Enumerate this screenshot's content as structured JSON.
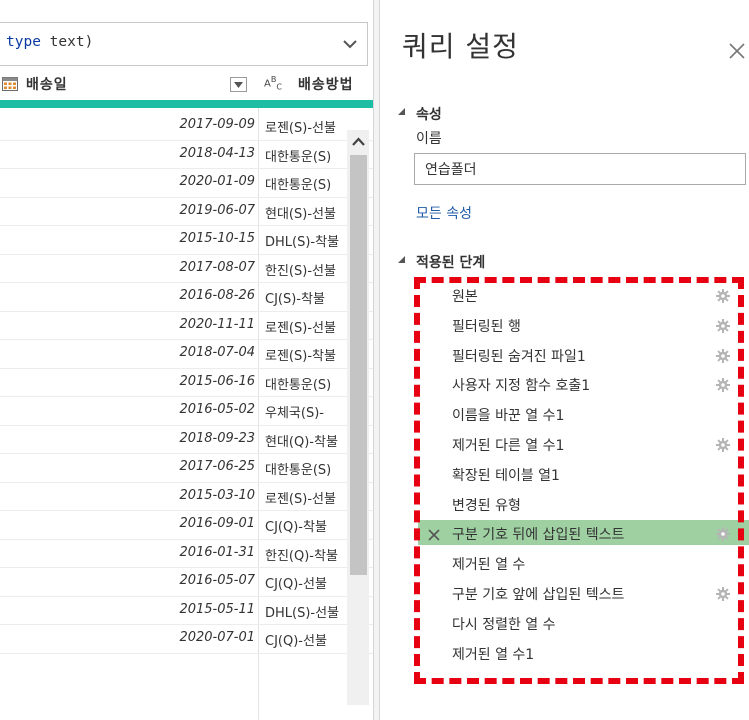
{
  "formula": {
    "kw": "type",
    "text": " text)"
  },
  "grid": {
    "date_column": "배송일",
    "ship_column": "배송방법",
    "type_badge": {
      "a": "A",
      "b": "B",
      "c": "C"
    },
    "rows": [
      {
        "date": "2017-09-09",
        "ship": "로젠(S)-선불"
      },
      {
        "date": "2018-04-13",
        "ship": "대한통운(S)"
      },
      {
        "date": "2020-01-09",
        "ship": "대한통운(S)"
      },
      {
        "date": "2019-06-07",
        "ship": "현대(S)-선불"
      },
      {
        "date": "2015-10-15",
        "ship": "DHL(S)-착불"
      },
      {
        "date": "2017-08-07",
        "ship": "한진(S)-선불"
      },
      {
        "date": "2016-08-26",
        "ship": "CJ(S)-착불"
      },
      {
        "date": "2020-11-11",
        "ship": "로젠(S)-선불"
      },
      {
        "date": "2018-07-04",
        "ship": "로젠(S)-착불"
      },
      {
        "date": "2015-06-16",
        "ship": "대한통운(S)"
      },
      {
        "date": "2016-05-02",
        "ship": "우체국(S)-"
      },
      {
        "date": "2018-09-23",
        "ship": "현대(Q)-착불"
      },
      {
        "date": "2017-06-25",
        "ship": "대한통운(S)"
      },
      {
        "date": "2015-03-10",
        "ship": "로젠(S)-선불"
      },
      {
        "date": "2016-09-01",
        "ship": "CJ(Q)-착불"
      },
      {
        "date": "2016-01-31",
        "ship": "한진(Q)-착불"
      },
      {
        "date": "2016-05-07",
        "ship": "CJ(Q)-선불"
      },
      {
        "date": "2015-05-11",
        "ship": "DHL(S)-선불"
      },
      {
        "date": "2020-07-01",
        "ship": "CJ(Q)-선불"
      }
    ]
  },
  "panel": {
    "title": "쿼리 설정",
    "properties_title": "속성",
    "name_label": "이름",
    "name_value": "연습폴더",
    "all_properties": "모든 속성",
    "steps_title": "적용된 단계",
    "steps": [
      {
        "label": "원본",
        "gear": true
      },
      {
        "label": "필터링된 행",
        "gear": true
      },
      {
        "label": "필터링된 숨겨진 파일1",
        "gear": true
      },
      {
        "label": "사용자 지정 함수 호출1",
        "gear": true
      },
      {
        "label": "이름을 바꾼 열 수1",
        "gear": false
      },
      {
        "label": "제거된 다른 열 수1",
        "gear": true
      },
      {
        "label": "확장된 테이블 열1",
        "gear": false
      },
      {
        "label": "변경된 유형",
        "gear": false
      },
      {
        "label": "구분 기호 뒤에 삽입된 텍스트",
        "gear": true,
        "selected": true
      },
      {
        "label": "제거된 열 수",
        "gear": false
      },
      {
        "label": "구분 기호 앞에 삽입된 텍스트",
        "gear": true
      },
      {
        "label": "다시 정렬한 열 수",
        "gear": false
      },
      {
        "label": "제거된 열 수1",
        "gear": false
      }
    ]
  },
  "colors": {
    "accent_teal": "#1ebea5",
    "selected_step": "#9ed0a2",
    "dashed_highlight": "#e60012",
    "link": "#1f5aa7"
  },
  "icons": {
    "table_icon": "calendar-icon",
    "dropdown": "chevron-down-icon",
    "close": "close-icon",
    "step_settings": "gear-icon",
    "delete_step": "x-icon",
    "section_toggle": "triangle-icon",
    "scroll_up": "scroll-up-arrow-icon"
  }
}
